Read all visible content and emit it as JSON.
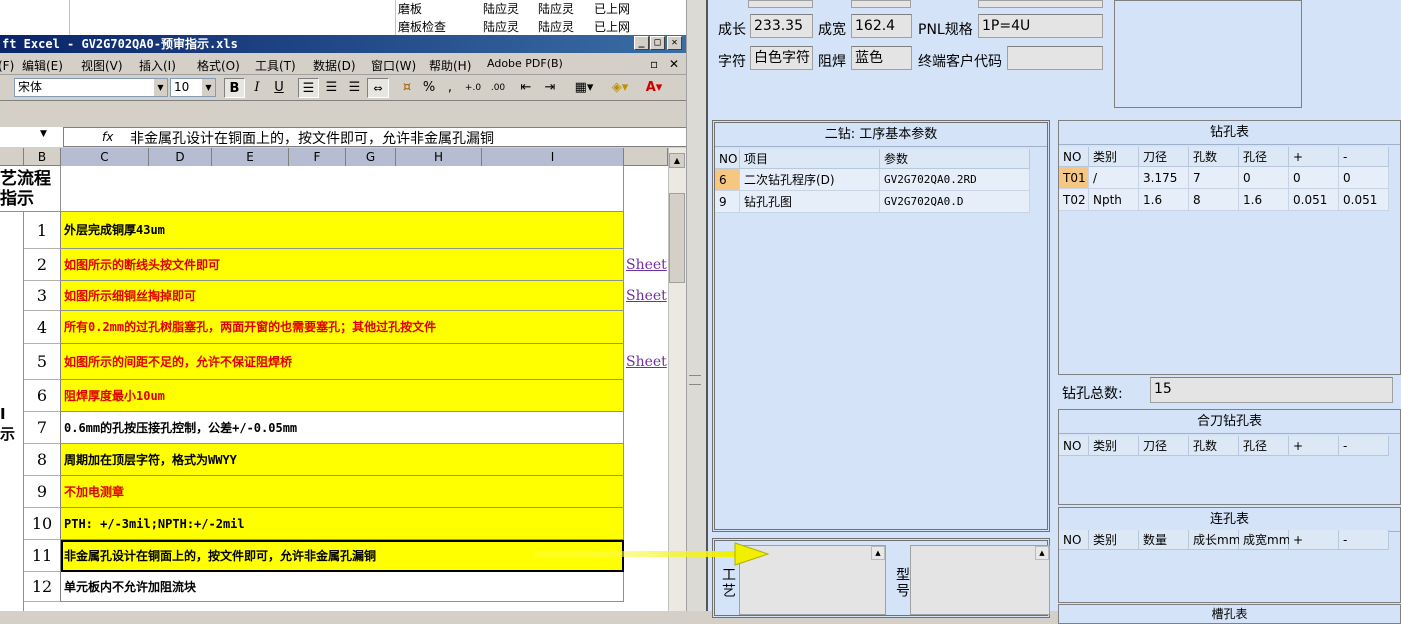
{
  "bg_window": {
    "rows": [
      [
        "磨板",
        "陆应灵",
        "陆应灵",
        "已上网"
      ],
      [
        "磨板检查",
        "陆应灵",
        "陆应灵",
        "已上网"
      ]
    ]
  },
  "excel": {
    "title": "ft Excel - GV2G702QA0-预审指示.xls",
    "menu": [
      "文件(F)",
      "编辑(E)",
      "视图(V)",
      "插入(I)",
      "格式(O)",
      "工具(T)",
      "数据(D)",
      "窗口(W)",
      "帮助(H)",
      "Adobe PDF(B)"
    ],
    "font_name": "宋体",
    "font_size": "10",
    "fx": "fx",
    "formula": "非金属孔设计在铜面上的，按文件即可，允许非金属孔漏铜",
    "columns": [
      "B",
      "C",
      "D",
      "E",
      "F",
      "G",
      "H",
      "I"
    ],
    "header_cell_a": "艺流程\n指示",
    "side_label": "I\n示",
    "rows": [
      {
        "n": "1",
        "text": "外层完成铜厚43um",
        "fill": "yellow",
        "color": "black",
        "link": ""
      },
      {
        "n": "2",
        "text": "如图所示的断线头按文件即可",
        "fill": "yellow",
        "color": "red",
        "link": "Sheet"
      },
      {
        "n": "3",
        "text": "如图所示细铜丝掏掉即可",
        "fill": "yellow",
        "color": "red",
        "link": "Sheet"
      },
      {
        "n": "4",
        "text": "所有0.2mm的过孔树脂塞孔，两面开窗的也需要塞孔；其他过孔按文件",
        "fill": "yellow",
        "color": "red",
        "link": ""
      },
      {
        "n": "5",
        "text": "如图所示的间距不足的，允许不保证阻焊桥",
        "fill": "yellow",
        "color": "red",
        "link": "Sheet"
      },
      {
        "n": "6",
        "text": "阻焊厚度最小10um",
        "fill": "yellow",
        "color": "red",
        "link": ""
      },
      {
        "n": "7",
        "text": "0.6mm的孔按压接孔控制，公差+/-0.05mm",
        "fill": "white",
        "color": "black",
        "link": ""
      },
      {
        "n": "8",
        "text": "周期加在顶层字符，格式为WWYY",
        "fill": "yellow",
        "color": "black",
        "link": ""
      },
      {
        "n": "9",
        "text": "不加电测章",
        "fill": "yellow",
        "color": "red",
        "link": ""
      },
      {
        "n": "10",
        "text": "PTH: +/-3mil;NPTH:+/-2mil",
        "fill": "yellow",
        "color": "black",
        "link": ""
      },
      {
        "n": "11",
        "text": "非金属孔设计在铜面上的，按文件即可，允许非金属孔漏铜",
        "fill": "yellow",
        "color": "black",
        "link": ""
      },
      {
        "n": "12",
        "text": "单元板内不允许加阻流块",
        "fill": "white",
        "color": "black",
        "link": ""
      }
    ]
  },
  "right": {
    "fields": {
      "len_label": "成长",
      "len_value": "233.35",
      "wid_label": "成宽",
      "wid_value": "162.4",
      "pnl_label": "PNL规格",
      "pnl_value": "1P=4U",
      "char_label": "字符",
      "char_value": "白色字符",
      "mask_label": "阻焊",
      "mask_value": "蓝色",
      "cust_label": "终端客户代码",
      "cust_value": ""
    },
    "drill2": {
      "title": "二钻: 工序基本参数",
      "headers": [
        "NO",
        "项目",
        "参数"
      ],
      "rows": [
        [
          "6",
          "二次钻孔程序(D)",
          "GV2G702QA0.2RD"
        ],
        [
          "9",
          "钻孔孔图",
          "GV2G702QA0.D"
        ]
      ]
    },
    "drill_table": {
      "title": "钻孔表",
      "headers": [
        "NO",
        "类别",
        "刀径",
        "孔数",
        "孔径",
        "+",
        "-"
      ],
      "rows": [
        [
          "T01",
          "/",
          "3.175",
          "7",
          "0",
          "0",
          "0"
        ],
        [
          "T02",
          "Npth",
          "1.6",
          "8",
          "1.6",
          "0.051",
          "0.051"
        ]
      ]
    },
    "total": {
      "label": "钻孔总数:",
      "value": "15"
    },
    "combo_table": {
      "title": "合刀钻孔表",
      "headers": [
        "NO",
        "类别",
        "刀径",
        "孔数",
        "孔径",
        "+",
        "-"
      ]
    },
    "slot_table": {
      "title": "连孔表",
      "headers": [
        "NO",
        "类别",
        "数量",
        "成长mm",
        "成宽mm",
        "+",
        "-"
      ]
    },
    "bottom_partial": "槽孔表",
    "process_label": "工艺",
    "model_label": "型号"
  },
  "colors": {
    "yellow": "#ffff00",
    "red": "#e00000",
    "panel": "#d4e3f7",
    "arrow": "#f0f000"
  }
}
